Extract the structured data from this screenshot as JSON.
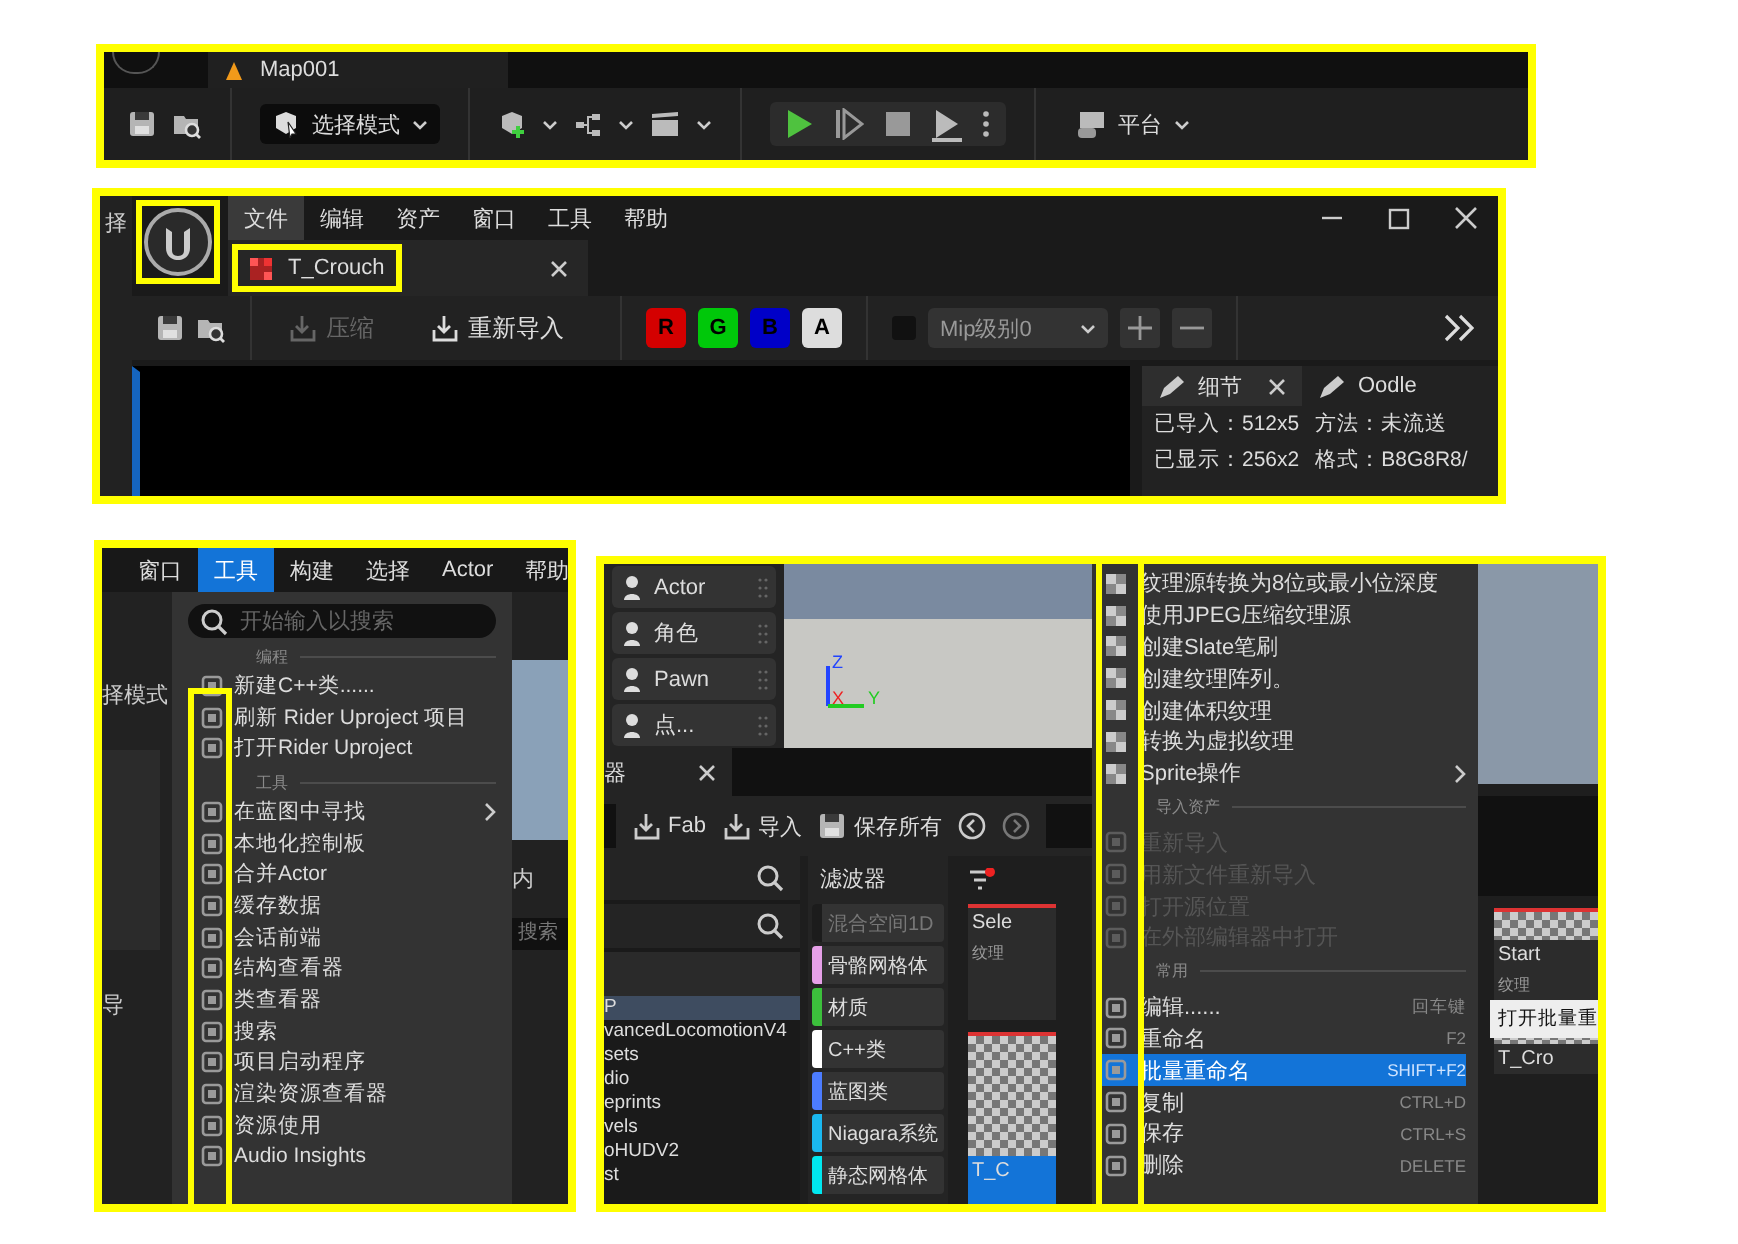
{
  "toolbar_panel": {
    "tab": "Map001",
    "mode_button": "选择模式",
    "platform_button": "平台"
  },
  "texture_editor": {
    "edge_text": "择",
    "logo_highlighted": true,
    "menu": [
      {
        "label": "文件",
        "selected": true
      },
      {
        "label": "编辑",
        "selected": false
      },
      {
        "label": "资产",
        "selected": false
      },
      {
        "label": "窗口",
        "selected": false
      },
      {
        "label": "工具",
        "selected": false
      },
      {
        "label": "帮助",
        "selected": false
      }
    ],
    "tab": {
      "label": "T_Crouch",
      "highlighted": true
    },
    "tools": [
      {
        "label": "压缩",
        "disabled": true
      },
      {
        "label": "重新导入",
        "disabled": false
      }
    ],
    "channels": [
      {
        "label": "R",
        "color": "#d40000"
      },
      {
        "label": "G",
        "color": "#00c80a"
      },
      {
        "label": "B",
        "color": "#0000c8"
      },
      {
        "label": "A",
        "color": "#dddddd"
      }
    ],
    "mip_checkbox": {
      "checked": false
    },
    "mip": "Mip级别0",
    "details_tabs": [
      {
        "label": "细节",
        "selected": true
      },
      {
        "label": "Oodle",
        "selected": false
      }
    ],
    "info": [
      [
        "已导入：512x5",
        "方法：未流送"
      ],
      [
        "已显示：256x2",
        "格式：B8G8R8/"
      ]
    ]
  },
  "tools_menu": {
    "menubar": [
      {
        "label": "窗口",
        "selected": false
      },
      {
        "label": "工具",
        "selected": true
      },
      {
        "label": "构建",
        "selected": false
      },
      {
        "label": "选择",
        "selected": false
      },
      {
        "label": "Actor",
        "selected": false
      },
      {
        "label": "帮助",
        "selected": false
      }
    ],
    "background": {
      "mode": "择模式",
      "import": "导",
      "content": "内",
      "search": "搜索"
    },
    "search_placeholder": "开始输入以搜索",
    "icon_column_highlighted": true,
    "sections": [
      {
        "heading": "编程",
        "items": [
          {
            "label": "新建C++类......",
            "submenu": false
          },
          {
            "label": "刷新 Rider Uproject 项目",
            "submenu": false
          },
          {
            "label": "打开Rider Uproject",
            "submenu": false
          }
        ]
      },
      {
        "heading": "工具",
        "items": [
          {
            "label": "在蓝图中寻找",
            "submenu": true
          },
          {
            "label": "本地化控制板",
            "submenu": false
          },
          {
            "label": "合并Actor",
            "submenu": false
          },
          {
            "label": "缓存数据",
            "submenu": false
          },
          {
            "label": "会话前端",
            "submenu": false
          },
          {
            "label": "结构查看器",
            "submenu": false
          },
          {
            "label": "类查看器",
            "submenu": false
          },
          {
            "label": "搜索",
            "submenu": false
          },
          {
            "label": "项目启动程序",
            "submenu": false
          },
          {
            "label": "渲染资源查看器",
            "submenu": false
          },
          {
            "label": "资源使用",
            "submenu": false
          },
          {
            "label": "Audio Insights",
            "submenu": false
          }
        ]
      }
    ]
  },
  "asset_panel": {
    "place_actors": [
      "Actor",
      "角色",
      "Pawn",
      "点..."
    ],
    "gizmo": [
      "Z",
      "X",
      "Y"
    ],
    "browser_tab": "器",
    "browser_tools": [
      "Fab",
      "导入",
      "保存所有"
    ],
    "folders": [
      {
        "label": "P",
        "selected": true
      },
      {
        "label": "vancedLocomotionV4",
        "selected": false
      },
      {
        "label": "sets",
        "selected": false
      },
      {
        "label": "dio",
        "selected": false
      },
      {
        "label": "eprints",
        "selected": false
      },
      {
        "label": "vels",
        "selected": false
      },
      {
        "label": "oHUDV2",
        "selected": false
      },
      {
        "label": "st",
        "selected": false
      }
    ],
    "filter_title": "滤波器",
    "filters": [
      {
        "label": "混合空间1D",
        "color": "#1c1c1c",
        "disabled": true
      },
      {
        "label": "骨骼网格体",
        "color": "#e6a0e8",
        "disabled": false
      },
      {
        "label": "材质",
        "color": "#3cc03c",
        "disabled": false
      },
      {
        "label": "C++类",
        "color": "#ffffff",
        "disabled": false
      },
      {
        "label": "蓝图类",
        "color": "#4c7cff",
        "disabled": false
      },
      {
        "label": "Niagara系统",
        "color": "#1ab8f0",
        "disabled": false
      },
      {
        "label": "静态网格体",
        "color": "#00e8f0",
        "disabled": false
      }
    ],
    "tiles": [
      {
        "label": "Sele",
        "type": "纹理",
        "selected": false
      },
      {
        "label": "T_C",
        "selected": true
      }
    ],
    "icon_column_highlighted": true,
    "context_menu": [
      {
        "items": [
          {
            "label": "纹理源转换为8位或最小位深度",
            "submenu": false,
            "disabled": false,
            "selected": false
          },
          {
            "label": "使用JPEG压缩纹理源",
            "submenu": false,
            "disabled": false,
            "selected": false
          },
          {
            "label": "创建Slate笔刷",
            "submenu": false,
            "disabled": false,
            "selected": false
          },
          {
            "label": "创建纹理阵列。",
            "submenu": false,
            "disabled": false,
            "selected": false
          },
          {
            "label": "创建体积纹理",
            "submenu": false,
            "disabled": false,
            "selected": false
          },
          {
            "label": "转换为虚拟纹理",
            "submenu": false,
            "disabled": false,
            "selected": false
          },
          {
            "label": "Sprite操作",
            "submenu": true,
            "disabled": false,
            "selected": false
          }
        ]
      },
      {
        "heading": "导入资产",
        "items": [
          {
            "label": "重新导入",
            "submenu": false,
            "disabled": true,
            "selected": false
          },
          {
            "label": "用新文件重新导入",
            "submenu": false,
            "disabled": true,
            "selected": false
          },
          {
            "label": "打开源位置",
            "submenu": false,
            "disabled": true,
            "selected": false
          },
          {
            "label": "在外部编辑器中打开",
            "submenu": false,
            "disabled": true,
            "selected": false
          }
        ]
      },
      {
        "heading": "常用",
        "items": [
          {
            "label": "编辑......",
            "shortcut": "回车键",
            "submenu": false,
            "disabled": false,
            "selected": false
          },
          {
            "label": "重命名",
            "shortcut": "F2",
            "submenu": false,
            "disabled": false,
            "selected": false
          },
          {
            "label": "批量重命名",
            "shortcut": "SHIFT+F2",
            "submenu": false,
            "disabled": false,
            "selected": true
          },
          {
            "label": "复制",
            "shortcut": "CTRL+D",
            "submenu": false,
            "disabled": false,
            "selected": false
          },
          {
            "label": "保存",
            "shortcut": "CTRL+S",
            "submenu": false,
            "disabled": false,
            "selected": false
          },
          {
            "label": "删除",
            "shortcut": "DELETE",
            "submenu": false,
            "disabled": false,
            "selected": false
          }
        ]
      }
    ],
    "right_tiles": [
      {
        "label": "Start",
        "type": "纹理"
      },
      {
        "label": "T_Cro"
      }
    ],
    "tooltip": "打开批量重"
  }
}
